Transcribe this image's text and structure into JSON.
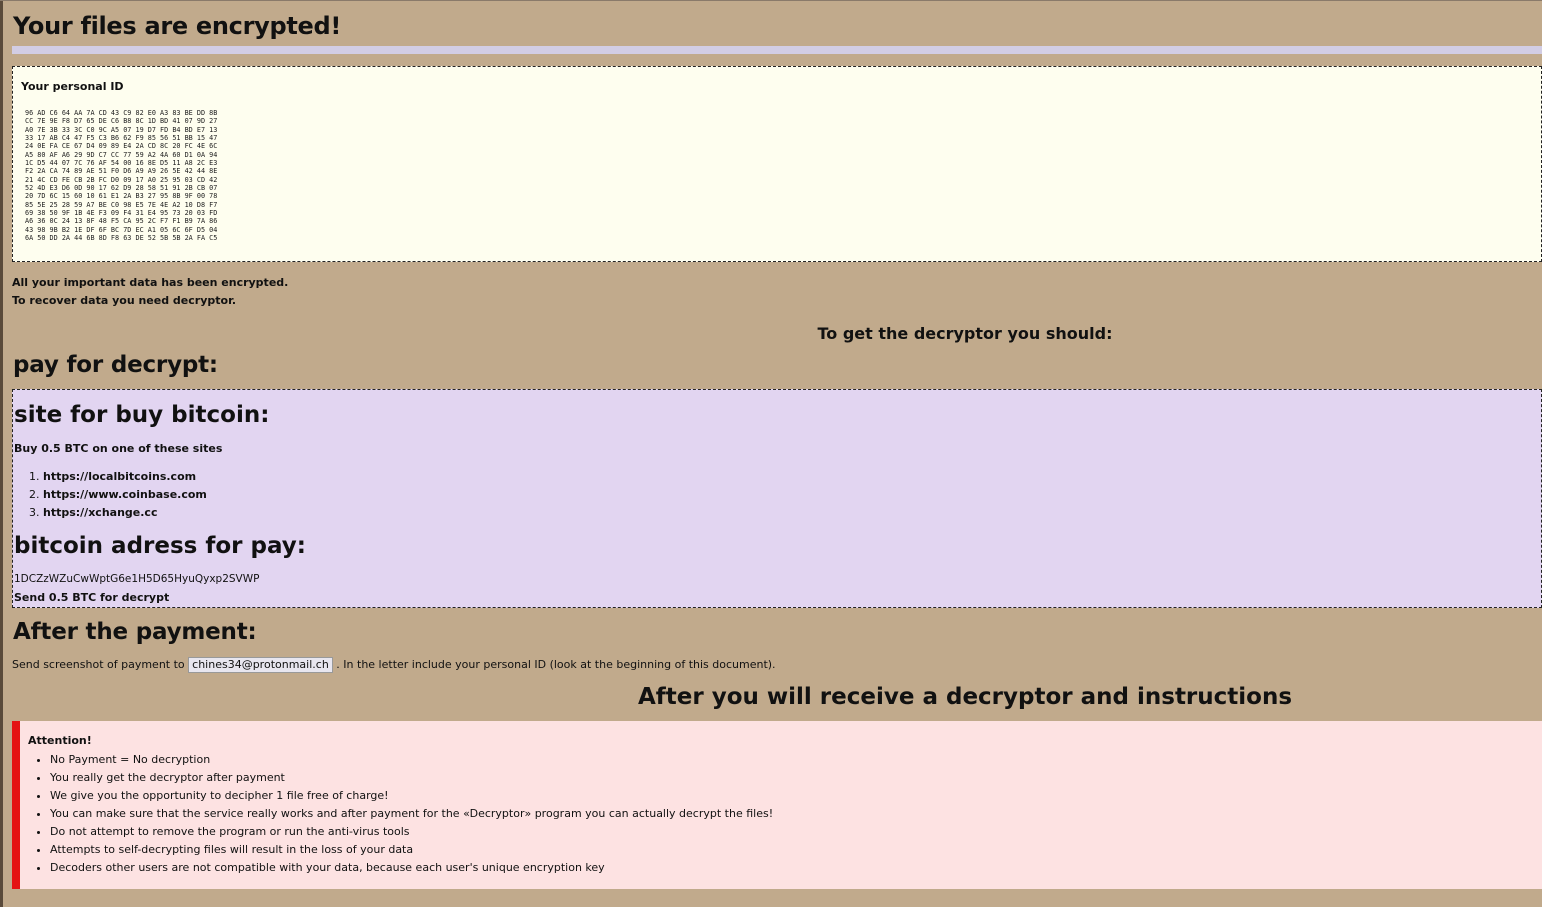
{
  "title": "Your files are encrypted!",
  "personal_id": {
    "label": "Your personal ID",
    "hex": "96 AD C6 64 AA 7A CD 43 C9 82 E0 A3 83 BE DD 8B\nCC 7E 9E F8 D7 65 DE C6 B8 8C 1D BD 41 07 9D 27\nA0 7E 3B 33 3C C0 9C A5 07 19 D7 FD B4 BD E7 13\n33 17 AB C4 47 F5 C3 B6 62 F9 85 56 51 BB 15 47\n24 0E FA CE 67 D4 09 89 E4 2A CD 8C 20 FC 4E 6C\nA5 80 AF A6 29 9D C7 CC 77 59 A2 4A 60 D1 0A 94\n1C D5 44 07 7C 76 AF 54 00 16 8E D5 11 A8 2C E3\nF2 2A CA 74 89 AE 51 F0 D6 A9 A9 26 5E 42 44 8E\n21 4C CD FE CB 2B FC D0 09 17 A0 25 95 03 CD 42\n52 4D E3 D6 0D 90 17 62 D9 28 58 51 91 2B CB 07\n20 7D 6C 15 60 10 61 E1 2A B3 27 95 8B 9F 00 78\n85 5E 25 28 59 A7 BE C0 98 E5 7E 4E A2 10 D8 F7\n69 38 50 9F 1B 4E F3 09 F4 31 E4 95 73 20 03 FD\nA6 36 0C 24 13 8F 48 F5 CA 95 2C F7 F1 B9 7A 86\n43 98 9B B2 1E DF 6F BC 7D EC A1 05 6C 6F D5 04\n6A 50 DD 2A 44 6B 8D F8 63 DE 52 5B 5B 2A FA C5"
  },
  "info": {
    "line1": "All your important data has been encrypted.",
    "line2": "To recover data you need decryptor."
  },
  "to_get_heading": "To get the decryptor you should:",
  "pay_heading": "pay for decrypt:",
  "buy_section": {
    "heading": "site for buy bitcoin:",
    "intro": "Buy 0.5 BTC on one of these sites",
    "sites": [
      "https://localbitcoins.com",
      "https://www.coinbase.com",
      "https://xchange.cc"
    ]
  },
  "address_section": {
    "heading": "bitcoin adress for pay:",
    "address": "1DCZzWZuCwWptG6e1H5D65HyuQyxp2SVWP",
    "send_note": "Send 0.5 BTC for decrypt"
  },
  "after_payment": {
    "heading": "After the payment:",
    "text_before": "Send screenshot of payment to",
    "email": "chines34@protonmail.ch",
    "text_after": ". In the letter include your personal ID (look at the beginning of this document)."
  },
  "final_heading": "After you will receive a decryptor and instructions",
  "attention": {
    "title": "Attention!",
    "items": [
      "No Payment = No decryption",
      "You really get the decryptor after payment",
      "We give you the opportunity to decipher 1 file free of charge!",
      "You can make sure that the service really works and after payment for the «Decryptor» program you can actually decrypt the files!",
      "Do not attempt to remove the program or run the anti-virus tools",
      "Attempts to self-decrypting files will result in the loss of your data",
      "Decoders other users are not compatible with your data, because each user's unique encryption key"
    ]
  },
  "colors": {
    "background": "#c1aa8c",
    "id_box": "#fefeef",
    "purple_box": "#e2d5f1",
    "attention_box": "#fde2e2",
    "attention_accent": "#e41313"
  }
}
